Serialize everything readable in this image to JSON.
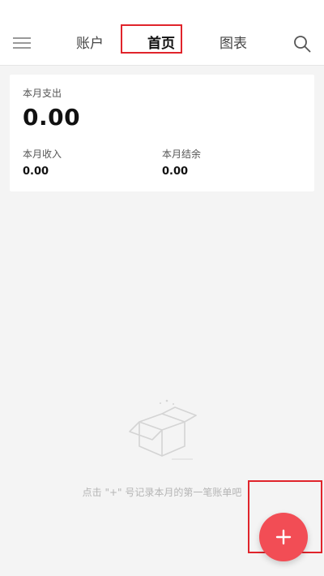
{
  "header": {
    "tabs": {
      "accounts": "账户",
      "home": "首页",
      "charts": "图表"
    },
    "menu_icon": "hamburger-menu-icon",
    "search_icon": "search-icon"
  },
  "summary": {
    "expense_label": "本月支出",
    "expense_value": "0.00",
    "income_label": "本月收入",
    "income_value": "0.00",
    "balance_label": "本月结余",
    "balance_value": "0.00"
  },
  "empty_state": {
    "icon": "empty-box-icon",
    "hint": "点击 \"+\" 号记录本月的第一笔账单吧"
  },
  "fab": {
    "icon": "plus-icon"
  },
  "colors": {
    "accent": "#f24d55",
    "highlight_box": "#e0242b",
    "background": "#f4f4f4"
  }
}
